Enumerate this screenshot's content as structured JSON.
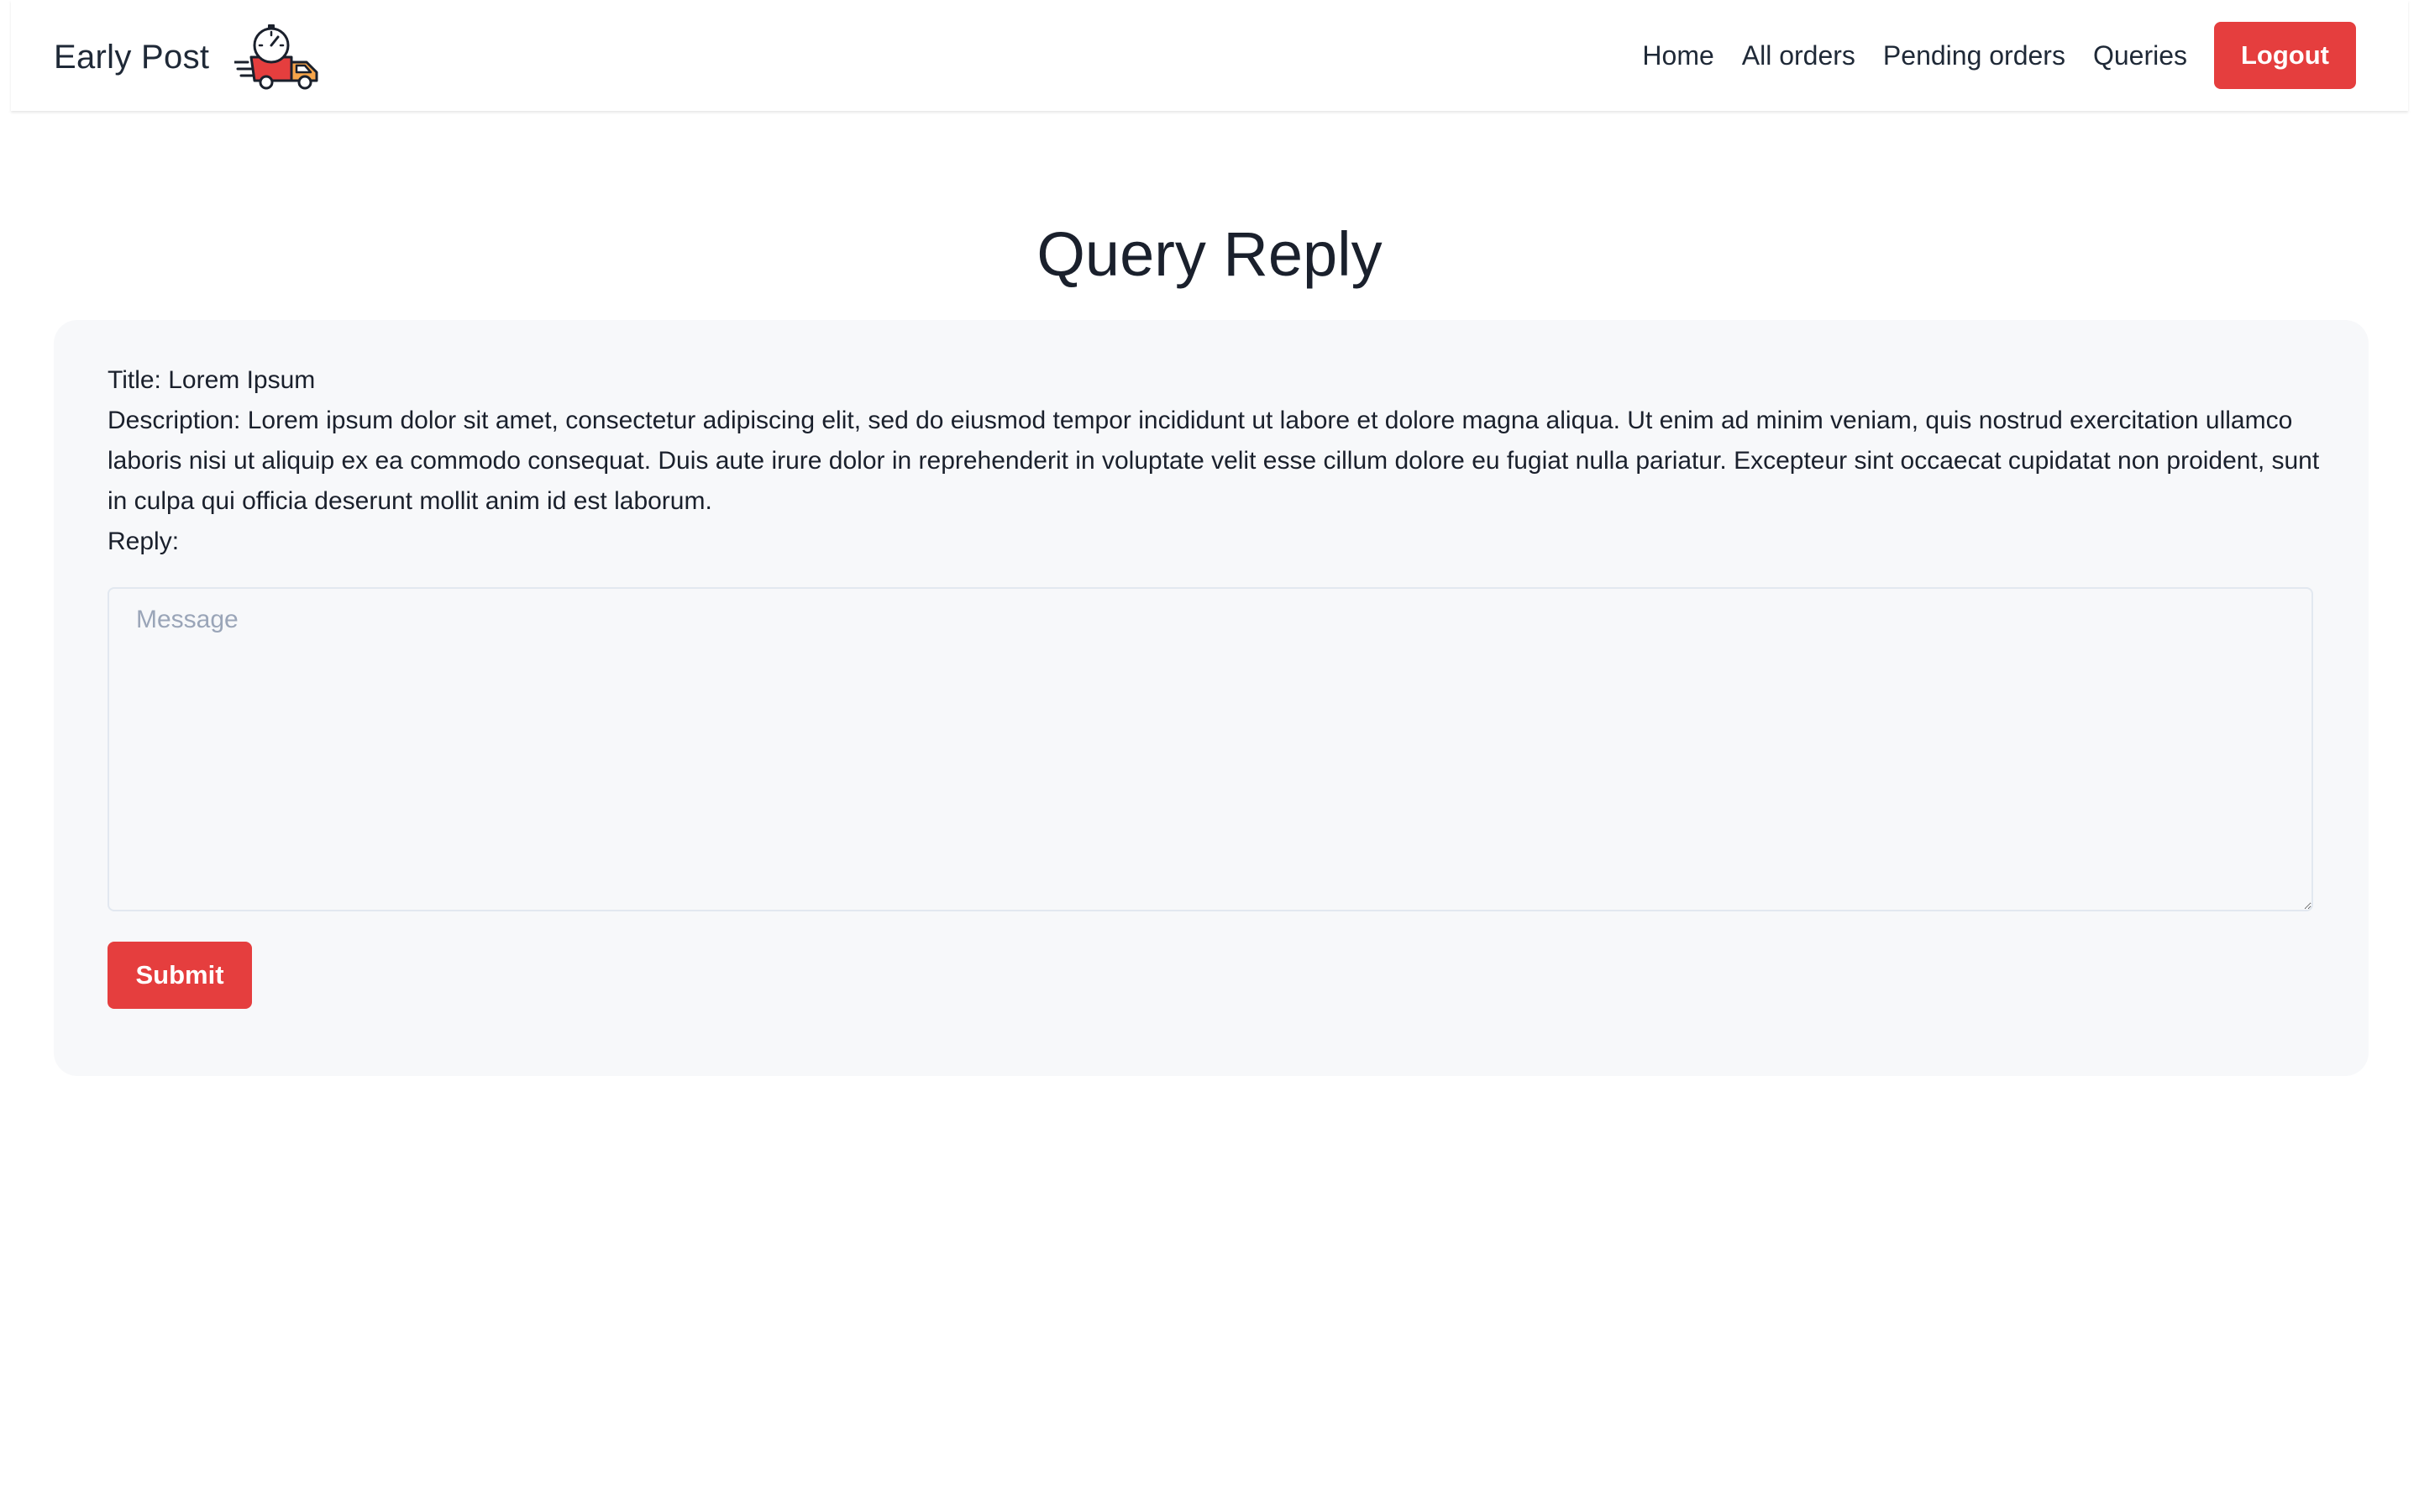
{
  "brand": {
    "name": "Early Post",
    "icon": "delivery-truck-icon"
  },
  "nav": {
    "links": [
      "Home",
      "All orders",
      "Pending orders",
      "Queries"
    ],
    "logout_label": "Logout"
  },
  "page": {
    "title": "Query Reply"
  },
  "query": {
    "title_line": "Title: Lorem Ipsum",
    "description_line": "Description: Lorem ipsum dolor sit amet, consectetur adipiscing elit, sed do eiusmod tempor incididunt ut labore et dolore magna aliqua. Ut enim ad minim veniam, quis nostrud exercitation ullamco laboris nisi ut aliquip ex ea commodo consequat. Duis aute irure dolor in reprehenderit in voluptate velit esse cillum dolore eu fugiat nulla pariatur. Excepteur sint occaecat cupidatat non proident, sunt in culpa qui officia deserunt mollit anim id est laborum.",
    "reply_label": "Reply:"
  },
  "form": {
    "message_placeholder": "Message",
    "message_value": "",
    "submit_label": "Submit"
  },
  "colors": {
    "accent": "#e53e3e",
    "card_background": "#f7f8fa",
    "text": "#1a202c"
  }
}
